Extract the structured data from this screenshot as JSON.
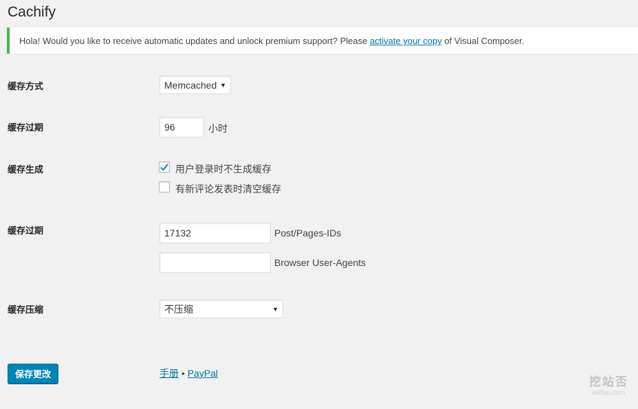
{
  "page": {
    "title": "Cachify"
  },
  "notice": {
    "text_before": "Hola! Would you like to receive automatic updates and unlock premium support? Please ",
    "link_text": "activate your copy",
    "text_after": " of Visual Composer."
  },
  "settings": {
    "cache_method": {
      "label": "缓存方式",
      "value": "Memcached"
    },
    "cache_expiry": {
      "label": "缓存过期",
      "value": "96",
      "unit": "小时"
    },
    "cache_generation": {
      "label": "缓存生成",
      "options": [
        {
          "label": "用户登录时不生成缓存",
          "checked": true
        },
        {
          "label": "有新评论发表时清空缓存",
          "checked": false
        }
      ]
    },
    "cache_exclusions": {
      "label": "缓存过期",
      "ids_value": "17132",
      "ids_suffix": "Post/Pages-IDs",
      "agents_value": "",
      "agents_suffix": "Browser User-Agents"
    },
    "cache_compression": {
      "label": "缓存压缩",
      "value": "不压缩"
    }
  },
  "actions": {
    "save_label": "保存更改"
  },
  "footer_links": {
    "manual": "手册",
    "separator": "•",
    "paypal": "PayPal"
  },
  "watermark": {
    "cn": "挖站否",
    "en": "wzfou.com"
  },
  "colors": {
    "primary": "#0085ba",
    "notice_border": "#46b450",
    "link": "#0073aa"
  }
}
